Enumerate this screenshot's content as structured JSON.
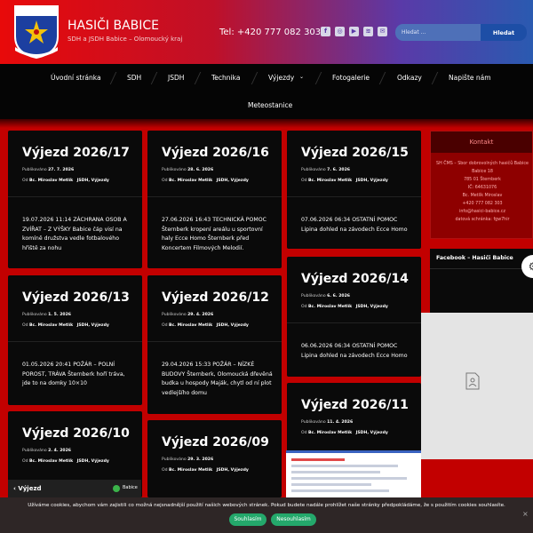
{
  "header": {
    "title": "HASIČI BABICE",
    "subtitle": "SDH a JSDH Babice – Olomoucký kraj",
    "phone": "Tel: +420 777 082 303",
    "logo_text_top": "HASIČI",
    "logo_text_bottom": "BABICE",
    "social_icons": [
      "facebook-icon",
      "instagram-icon",
      "youtube-icon",
      "rss-icon",
      "email-icon"
    ],
    "search": {
      "placeholder": "Hledat …",
      "button": "Hledat"
    }
  },
  "nav": {
    "items": [
      "Úvodní stránka",
      "SDH",
      "JSDH",
      "Technika",
      "Výjezdy",
      "Fotogalerie",
      "Odkazy",
      "Napište nám"
    ],
    "row2": [
      "Meteostanice"
    ],
    "dropdown_icon": "chevron-down-icon"
  },
  "posts": [
    {
      "title": "Výjezd 2026/17",
      "published_label": "Publikováno",
      "date": "27. 7. 2026",
      "by_label": "Od",
      "author": "Bc. Miroslav Metlík",
      "categories": "JSDH, Výjezdy",
      "excerpt": "19.07.2026 11:14 ZÁCHRANA OSOB A ZVÍŘAT – Z VÝŠKY Babice čáp visí na komíně družstva vedle fotbalového hřiště za nohu"
    },
    {
      "title": "Výjezd 2026/16",
      "published_label": "Publikováno",
      "date": "28. 6. 2026",
      "by_label": "Od",
      "author": "Bc. Miroslav Metlík",
      "categories": "JSDH, Výjezdy",
      "excerpt": "27.06.2026 16:43 TECHNICKÁ POMOC Šternberk kropení areálu u sportovní haly Ecce Homo Šternberk před Koncertem Filmových Melodií."
    },
    {
      "title": "Výjezd 2026/15",
      "published_label": "Publikováno",
      "date": "7. 6. 2026",
      "by_label": "Od",
      "author": "Bc. Miroslav Metlík",
      "categories": "JSDH, Výjezdy",
      "excerpt": "07.06.2026 06:34 OSTATNÍ POMOC Lipina dohled na závodech Ecce Homo"
    },
    {
      "title": "Výjezd 2026/13",
      "published_label": "Publikováno",
      "date": "1. 5. 2026",
      "by_label": "Od",
      "author": "Bc. Miroslav Metlík",
      "categories": "JSDH, Výjezdy",
      "excerpt": "01.05.2026 20:41 POŽÁR – POLNÍ POROST, TRÁVA Šternberk hoří tráva, jde to na domky 10×10"
    },
    {
      "title": "Výjezd 2026/12",
      "published_label": "Publikováno",
      "date": "29. 4. 2026",
      "by_label": "Od",
      "author": "Bc. Miroslav Metlík",
      "categories": "JSDH, Výjezdy",
      "excerpt": "29.04.2026 15:33 POŽÁR – NÍZKÉ BUDOVY Šternberk, Olomoucká dřevěná budka u hospody Maják, chytl od ní plot vedlejšího domu"
    },
    {
      "title": "Výjezd 2026/14",
      "published_label": "Publikováno",
      "date": "6. 6. 2026",
      "by_label": "Od",
      "author": "Bc. Miroslav Metlík",
      "categories": "JSDH, Výjezdy",
      "excerpt": "06.06.2026 06:34 OSTATNÍ POMOC Lipina dohled na závodech Ecce Homo"
    },
    {
      "title": "Výjezd 2026/10",
      "published_label": "Publikováno",
      "date": "2. 4. 2026",
      "by_label": "Od",
      "author": "Bc. Miroslav Metlík",
      "categories": "JSDH, Výjezdy",
      "excerpt": ""
    },
    {
      "title": "Výjezd 2026/09",
      "published_label": "Publikováno",
      "date": "29. 3. 2026",
      "by_label": "Od",
      "author": "Bc. Miroslav Metlík",
      "categories": "JSDH, Výjezdy",
      "excerpt": ""
    },
    {
      "title": "Výjezd 2026/11",
      "published_label": "Publikováno",
      "date": "11. 4. 2026",
      "by_label": "Od",
      "author": "Bc. Miroslav Metlík",
      "categories": "JSDH, Výjezdy",
      "excerpt": ""
    }
  ],
  "sidebar": {
    "kontakt_title": "Kontakt",
    "kontakt_lines": [
      "SH ČMS – Sbor dobrovolných hasičů Babice",
      "Babice 18",
      "785 01 Šternberk",
      "IČ: 64631076",
      "Bc. Metlík Miroslav",
      "+420 777 082 303",
      "info@hasici-babice.cz",
      "datová schránka: fgw7hir"
    ],
    "facebook_title": "Facebook – Hasiči Babice"
  },
  "widget": {
    "back_label": "Výjezd",
    "page_label": "Babice"
  },
  "cookie": {
    "text": "Užíváme cookies, abychom vám zajistili co možná nejsnadnější použití našich webových stránek. Pokud budete nadále prohlížet naše stránky předpokládáme, že s použitím cookies souhlasíte.",
    "accept": "Souhlasím",
    "decline": "Nesouhlasím",
    "close": "×"
  }
}
